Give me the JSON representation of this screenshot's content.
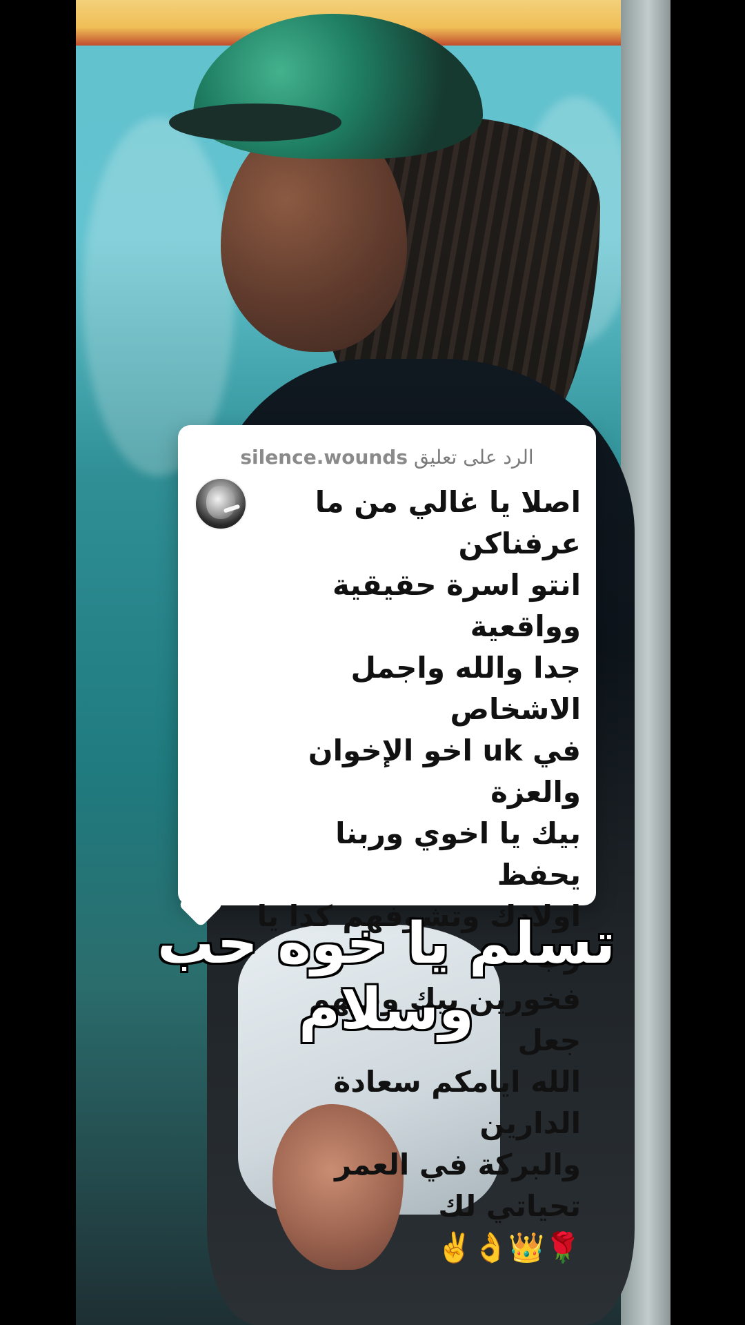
{
  "comment_card": {
    "reply_prefix": "الرد على تعليق",
    "username": "silence.wounds",
    "text": "اصلا يا غالي من ما عرفناكن\nانتو اسرة حقيقية وواقعية\nجدا والله واجمل الاشخاص\nفي uk اخو الإخوان والعزة\nبيك يا اخوي وربنا يحفظ\nاولادك وتشوفهم كدا يا رب\nفخورين بيك وفيهم جعل\nالله ايامكم سعادة الدارين\nوالبركة في العمر تحياتي لك\n🌹👑👌✌️"
  },
  "caption": {
    "text": "تسلم يا خوه حب وسلام"
  },
  "colors": {
    "card_background": "#ffffff",
    "caption_fill": "#ffffff",
    "caption_outline": "#000000",
    "meta_text": "#7a7a7a"
  },
  "icons": {
    "avatar": "user-avatar"
  }
}
